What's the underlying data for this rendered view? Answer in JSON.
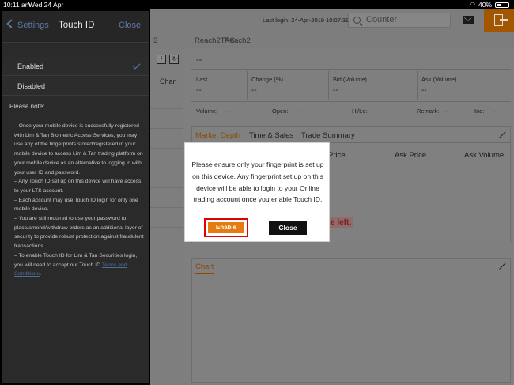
{
  "status_bar": {
    "time": "10:11 am",
    "date": "Wed 24 Apr",
    "battery": "40%",
    "battery_level": 0.4
  },
  "header": {
    "last_login": "Last login: 24-Apr-2019 10:07:39",
    "search_placeholder": "Counter"
  },
  "tabs": [
    "3",
    "Reach2TAC",
    "Reach2"
  ],
  "left_column": {
    "change_label": "Chan"
  },
  "quote": {
    "title": "--",
    "fields": [
      {
        "label": "Last",
        "value": "--"
      },
      {
        "label": "Change (%)",
        "value": "--"
      },
      {
        "label": "Bid (Volume)",
        "value": "--"
      },
      {
        "label": "Ask (Volume)",
        "value": "--"
      }
    ],
    "stats": [
      {
        "label": "Volume:",
        "value": "--"
      },
      {
        "label": "Open:",
        "value": "--"
      },
      {
        "label": "Hi/Lo:",
        "value": "--"
      },
      {
        "label": "Remark:",
        "value": "--"
      },
      {
        "label": "Ind:",
        "value": "--"
      }
    ]
  },
  "market_panel": {
    "tabs": [
      "Market Depth",
      "Time & Sales",
      "Trade Summary"
    ],
    "columns": [
      "Price",
      "Ask Price",
      "Ask Volume"
    ],
    "notice": "e left."
  },
  "chart_panel": {
    "title": "Chart"
  },
  "side_panel": {
    "back_label": "Settings",
    "title": "Touch ID",
    "close_label": "Close",
    "options": [
      "Enabled",
      "Disabled"
    ],
    "note_label": "Please note:",
    "notes_before_link": "– Once your mobile device is successfully registered with Lim & Tan Biometric Access Services, you may use any of the fingerprints stored/registered in your mobile device to access Lim & Tan trading platform on your mobile device as an alternative to logging in with your user ID and password.\n– Any Touch ID set up on this device will have access to your LTS account.\n– Each account may use Touch ID login for only one mobile device.\n– You are still required to use your password to place/amend/withdraw orders as an additional layer of security to provide robust protection against fraudulent transactions.\n– To enable Touch ID for Lim & Tan Securities login, you will need to accept our Touch ID ",
    "notes_link": "Terms and Conditions",
    "notes_after_link": "."
  },
  "modal": {
    "message": "Please ensure only your fingerprint is set up on this device. Any fingerprint set up on this device will be able to login to your Online trading account once you enable Touch ID.",
    "enable_label": "Enable",
    "close_label": "Close"
  }
}
